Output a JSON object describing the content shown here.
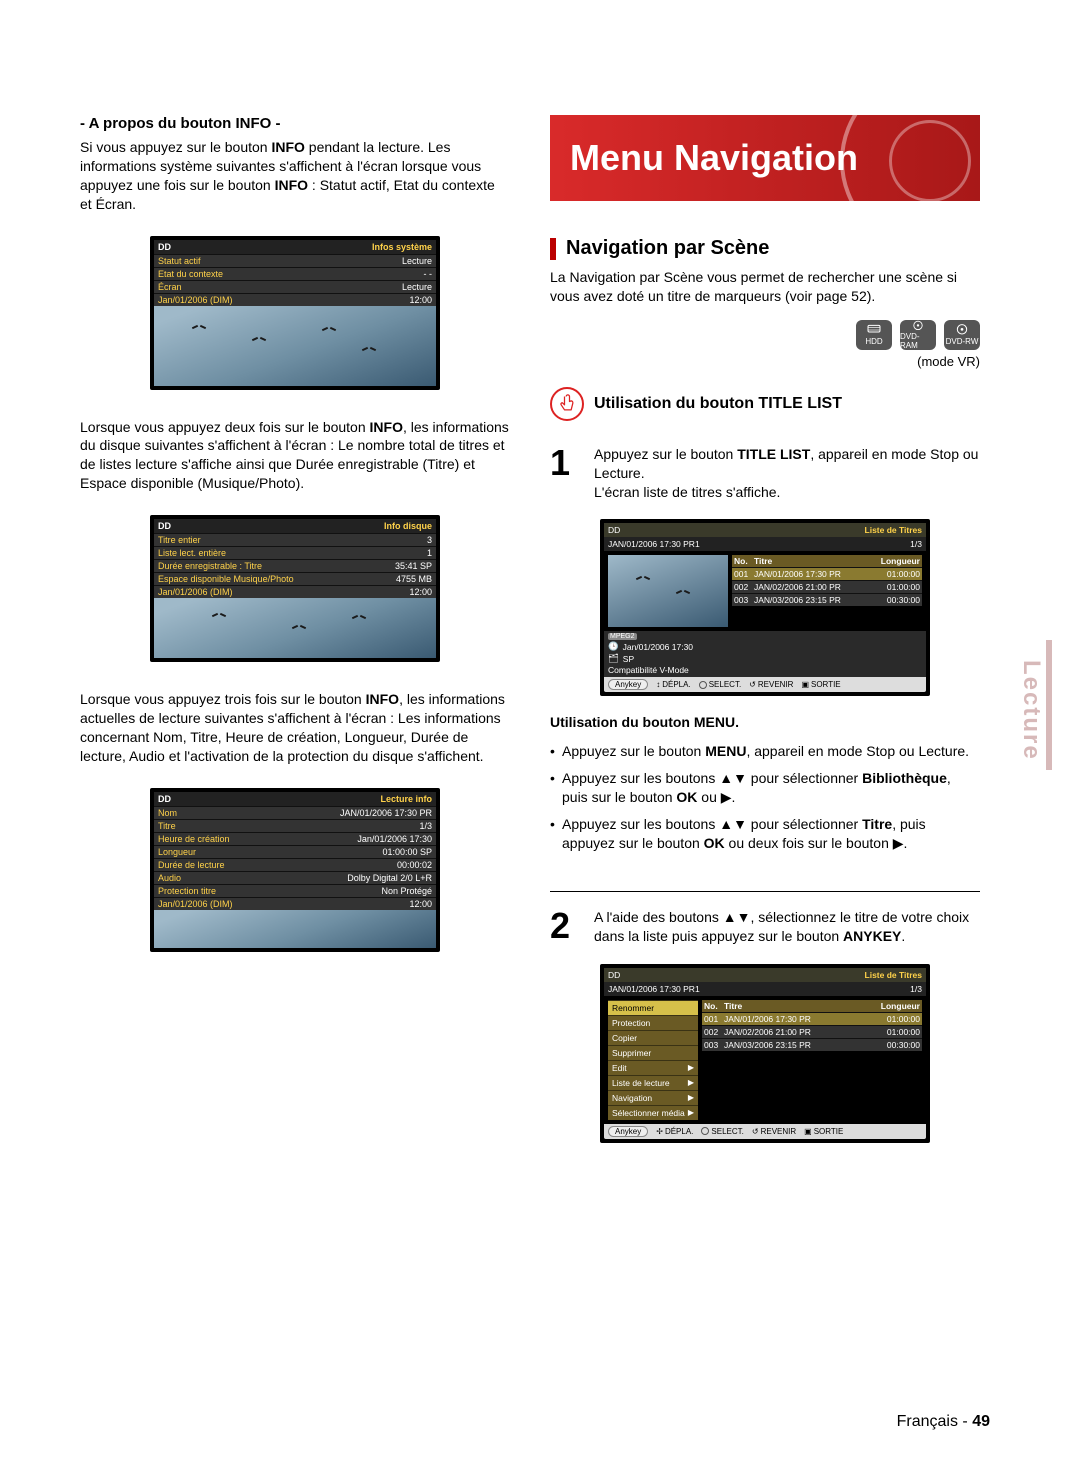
{
  "left": {
    "info_heading": "- A propos du bouton INFO -",
    "para1_a": "Si vous appuyez sur le bouton ",
    "para1_b": "INFO",
    "para1_c": " pendant la lecture. Les informations système suivantes s'affichent à l'écran lorsque vous appuyez une fois sur le bouton ",
    "para1_d": "INFO",
    "para1_e": " : Statut actif, Etat du contexte et Écran.",
    "osd1": {
      "dd": "DD",
      "title": "Infos système",
      "rows": [
        {
          "l": "Statut actif",
          "v": "Lecture"
        },
        {
          "l": "Etat du contexte",
          "v": "- -"
        },
        {
          "l": "Écran",
          "v": "Lecture"
        },
        {
          "l": "Jan/01/2006 (DIM)",
          "v": "12:00"
        }
      ]
    },
    "para2_a": "Lorsque vous appuyez deux fois sur le bouton ",
    "para2_b": "INFO",
    "para2_c": ", les informations du disque suivantes s'affichent à l'écran : Le nombre total de titres et de listes lecture s'affiche ainsi que Durée enregistrable (Titre) et Espace disponible (Musique/Photo).",
    "osd2": {
      "dd": "DD",
      "title": "Info disque",
      "rows": [
        {
          "l": "Titre entier",
          "v": "3"
        },
        {
          "l": "Liste lect. entière",
          "v": "1"
        },
        {
          "l": "Durée enregistrable : Titre",
          "v": "35:41  SP"
        },
        {
          "l": "Espace disponible Musique/Photo",
          "v": "4755 MB"
        },
        {
          "l": "Jan/01/2006 (DIM)",
          "v": "12:00"
        }
      ]
    },
    "para3_a": "Lorsque vous appuyez trois fois sur le bouton ",
    "para3_b": "INFO",
    "para3_c": ", les informations actuelles de lecture suivantes s'affichent à l'écran : Les informations concernant Nom, Titre, Heure de création, Longueur, Durée de lecture, Audio et l'activation de la protection du disque s'affichent.",
    "osd3": {
      "dd": "DD",
      "title": "Lecture info",
      "rows": [
        {
          "l": "Nom",
          "v": "JAN/01/2006 17:30 PR"
        },
        {
          "l": "Titre",
          "v": "1/3"
        },
        {
          "l": "Heure de création",
          "v": "Jan/01/2006 17:30"
        },
        {
          "l": "Longueur",
          "v": "01:00:00 SP"
        },
        {
          "l": "Durée de lecture",
          "v": "00:00:02"
        },
        {
          "l": "Audio",
          "v": "Dolby Digital 2/0 L+R"
        },
        {
          "l": "Protection titre",
          "v": "Non Protégé"
        },
        {
          "l": "Jan/01/2006 (DIM)",
          "v": "12:00"
        }
      ]
    }
  },
  "right": {
    "banner": "Menu Navigation",
    "nav_heading": "Navigation par Scène",
    "nav_para": "La Navigation par Scène vous permet de rechercher une scène si vous avez doté un titre de marqueurs (voir page 52).",
    "disc_labels": [
      "HDD",
      "DVD-RAM",
      "DVD-RW"
    ],
    "mode_label": "(mode VR)",
    "util_title": "Utilisation du bouton TITLE LIST",
    "step1_num": "1",
    "step1_a": "Appuyez sur le bouton ",
    "step1_b": "TITLE LIST",
    "step1_c": ", appareil en mode Stop ou Lecture.",
    "step1_d": "L'écran liste de titres s'affiche.",
    "tl": {
      "top_left": "DD",
      "top_right": "Liste de Titres",
      "sub_left": "JAN/01/2006 17:30 PR1",
      "sub_right": "1/3",
      "head_no": "No.",
      "head_title": "Titre",
      "head_len": "Longueur",
      "rows": [
        {
          "no": "001",
          "t": "JAN/01/2006 17:30  PR",
          "len": "01:00:00"
        },
        {
          "no": "002",
          "t": "JAN/02/2006 21:00  PR",
          "len": "01:00:00"
        },
        {
          "no": "003",
          "t": "JAN/03/2006 23:15  PR",
          "len": "00:30:00"
        }
      ],
      "meta_icon1": "MPEG2",
      "meta_line1": "Jan/01/2006 17:30",
      "meta_line2": "SP",
      "meta_line3": "Compatibilité V-Mode",
      "footer_anykey": "Anykey",
      "footer_labels": [
        "DÉPLA.",
        "SELECT.",
        "REVENIR",
        "SORTIE"
      ]
    },
    "menu_sub_heading": "Utilisation du bouton MENU.",
    "bul1_a": "Appuyez sur le bouton ",
    "bul1_b": "MENU",
    "bul1_c": ", appareil en mode Stop ou Lecture.",
    "bul2_a": "Appuyez sur les boutons ▲▼ pour sélectionner ",
    "bul2_b": "Bibliothèque",
    "bul2_c": ", puis sur le bouton ",
    "bul2_d": "OK",
    "bul2_e": " ou ▶.",
    "bul3_a": "Appuyez sur les boutons ▲▼ pour sélectionner ",
    "bul3_b": "Titre",
    "bul3_c": ", puis appuyez sur le bouton ",
    "bul3_d": "OK",
    "bul3_e": " ou deux fois sur le bouton ▶.",
    "step2_num": "2",
    "step2_a": "A l'aide des boutons ▲▼, sélectionnez le titre de votre choix dans la liste puis appuyez sur le bouton ",
    "step2_b": "ANYKEY",
    "step2_c": ".",
    "ctx": {
      "items": [
        "Renommer",
        "Protection",
        "Copier",
        "Supprimer",
        "Edit",
        "Liste de lecture",
        "Navigation",
        "Sélectionner média"
      ]
    }
  },
  "tab_label": "Lecture",
  "footer_lang": "Français",
  "footer_sep": " - ",
  "footer_page": "49"
}
